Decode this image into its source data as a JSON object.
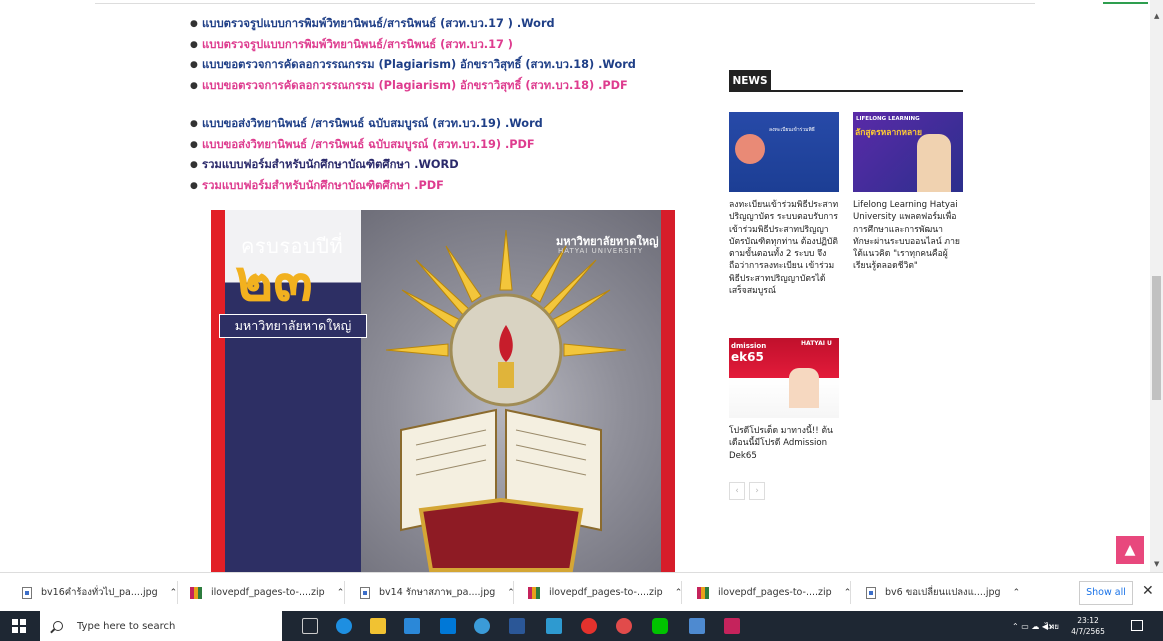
{
  "links": [
    {
      "text": "แบบตรวจรูปแบบการพิมพ์วิทยานิพนธ์/สารนิพนธ์ (สวท.บว.17 ) .Word",
      "color": "blue"
    },
    {
      "text": "แบบตรวจรูปแบบการพิมพ์วิทยานิพนธ์/สารนิพนธ์ (สวท.บว.17 )",
      "color": "pink"
    },
    {
      "text": "แบบขอตรวจการคัดลอกวรรณกรรม (Plagiarism) อักขราวิสุทธิ์ (สวท.บว.18) .Word",
      "color": "blue"
    },
    {
      "text": "แบบขอตรวจการคัดลอกวรรณกรรม (Plagiarism) อักขราวิสุทธิ์ (สวท.บว.18) .PDF",
      "color": "pink"
    },
    {
      "text": "แบบขอส่งวิทยานิพนธ์ /สารนิพนธ์ ฉบับสมบูรณ์ (สวท.บว.19) .Word",
      "color": "blue"
    },
    {
      "text": "แบบขอส่งวิทยานิพนธ์ /สารนิพนธ์ ฉบับสมบูรณ์ (สวท.บว.19) .PDF",
      "color": "pink"
    },
    {
      "text": "รวมแบบฟอร์มสำหรับนักศึกษาบัณฑิตศึกษา .WORD",
      "color": "navy"
    },
    {
      "text": "รวมแบบฟอร์มสำหรับนักศึกษาบัณฑิตศึกษา .PDF",
      "color": "pink"
    }
  ],
  "poster": {
    "anniversary": "ครบรอบปีที่",
    "number": "๒๓",
    "university_th": "มหาวิทยาลัยหาดใหญ่",
    "brand_th": "มหาวิทยาลัยหาดใหญ่",
    "brand_en": "HATYAI UNIVERSITY"
  },
  "news": {
    "heading": "NEWS",
    "items": [
      {
        "text": "ลงทะเบียนเข้าร่วมพิธีประสาทปริญญาบัตร ระบบตอบรับการเข้าร่วมพิธีประสาทปริญญาบัตรบัณฑิตทุกท่าน ต้องปฏิบัติตามขั้นตอนทั้ง 2 ระบบ จึงถือว่าการลงทะเบียน เข้าร่วมพิธีประสาทปริญญาบัตรได้เสร็จสมบูรณ์"
      },
      {
        "text": "Lifelong Learning Hatyai University แพลตฟอร์มเพื่อการศึกษาและการพัฒนาทักษะผ่านระบบออนไลน์ ภายใต้แนวคิด \"เราทุกคนคือผู้เรียนรู้ตลอดชีวิต\""
      },
      {
        "text": "โปรดีโปรเด็ด มาทางนี้!! ต้นเดือนนี้มีโปรดี Admission Dek65"
      }
    ],
    "thumb1_text": "ลงทะเบียนเข้าร่วมพิธี",
    "thumb2_line1": "LIFELONG LEARNING",
    "thumb2_line2": "ลักสูตรหลากหลาย",
    "thumb3_line1": "dmission",
    "thumb3_line2": "ek65",
    "thumb3_brand": "HATYAI U",
    "pager_prev": "‹",
    "pager_next": "›"
  },
  "scroll_top_icon": "chevron-up-icon",
  "downloads": {
    "items": [
      {
        "name": "bv16คำร้องทั่วไป_pa....jpg",
        "type": "file"
      },
      {
        "name": "ilovepdf_pages-to-....zip",
        "type": "zip"
      },
      {
        "name": "bv14 รักษาสภาพ_pa....jpg",
        "type": "file"
      },
      {
        "name": "ilovepdf_pages-to-....zip",
        "type": "zip"
      },
      {
        "name": "ilovepdf_pages-to-....zip",
        "type": "zip"
      },
      {
        "name": "bv6 ขอเปลี่ยนแปลงแ....jpg",
        "type": "file"
      }
    ],
    "show_all": "Show all",
    "close": "✕"
  },
  "taskbar": {
    "search_placeholder": "Type here to search",
    "lang": "ไทย",
    "time": "23:12",
    "date": "4/7/2565"
  }
}
